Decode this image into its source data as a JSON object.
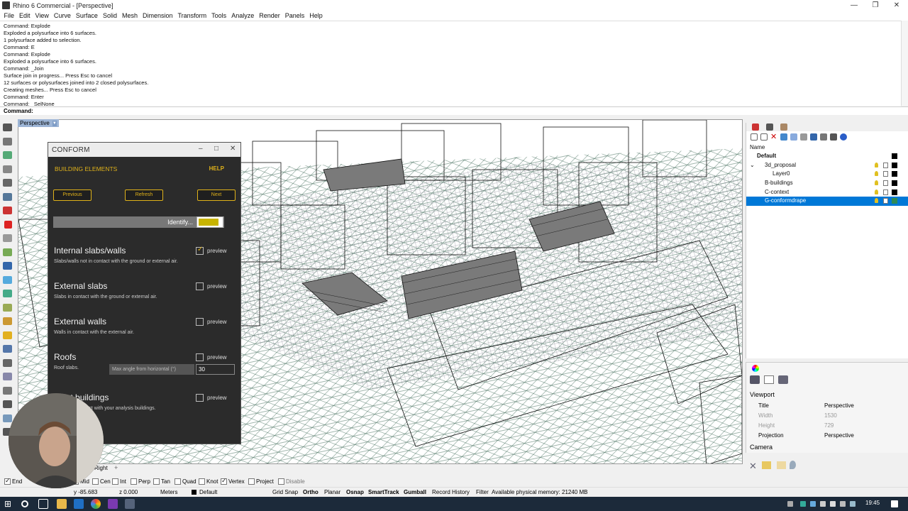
{
  "window": {
    "title": "Rhino 6 Commercial - [Perspective]"
  },
  "menu": [
    "File",
    "Edit",
    "View",
    "Curve",
    "Surface",
    "Solid",
    "Mesh",
    "Dimension",
    "Transform",
    "Tools",
    "Analyze",
    "Render",
    "Panels",
    "Help"
  ],
  "command_history": [
    "Command: Explode",
    "Exploded a polysurface into 6 surfaces.",
    "1 polysurface added to selection.",
    "Command: E",
    "Command: Explode",
    "Exploded a polysurface into 6 surfaces.",
    "Command: _Join",
    "Surface join in progress... Press Esc to cancel",
    "12 surfaces or polysurfaces joined into 2 closed polysurfaces.",
    "Creating meshes... Press Esc to cancel",
    "Command: Enter",
    "Command: _SelNone"
  ],
  "command_prompt": "Command:",
  "viewport": {
    "tab": "Perspective",
    "dropdown_glyph": "▼"
  },
  "conform": {
    "title": "CONFORM",
    "heading": "BUILDING ELEMENTS",
    "help": "HELP",
    "buttons": {
      "previous": "Previous",
      "refresh": "Refresh",
      "next": "Next"
    },
    "identify": "Identify...",
    "identify_color": "#c8b400",
    "preview_label": "preview",
    "sections": [
      {
        "title": "Internal slabs/walls",
        "desc": "Slabs/walls not in contact with the ground or external air.",
        "checked": true
      },
      {
        "title": "External slabs",
        "desc": "Slabs in contact with the ground or external air.",
        "checked": false
      },
      {
        "title": "External walls",
        "desc": "Walls in contact with the external air.",
        "checked": false
      },
      {
        "title": "Roofs",
        "desc": "Roof slabs.",
        "checked": false
      },
      {
        "title": "...ent buildings",
        "desc": "...in direct contact with your analysis buildings.",
        "checked": false
      }
    ],
    "angle_label": "Max angle from horizontal (°)",
    "angle_value": "30"
  },
  "layers": {
    "header": "Name",
    "rows": [
      {
        "name": "Default",
        "bold": true,
        "indent": 0
      },
      {
        "name": "3d_proposal",
        "bold": false,
        "indent": 1,
        "expand": "⌄"
      },
      {
        "name": "Layer0",
        "bold": false,
        "indent": 2
      },
      {
        "name": "B-buildings",
        "bold": false,
        "indent": 1
      },
      {
        "name": "C-context",
        "bold": false,
        "indent": 1
      },
      {
        "name": "G-conformdrape",
        "bold": false,
        "indent": 1,
        "selected": true
      }
    ]
  },
  "properties": {
    "section": "Viewport",
    "rows": [
      {
        "key": "Title",
        "value": "Perspective",
        "dim": false
      },
      {
        "key": "Width",
        "value": "1530",
        "dim": true
      },
      {
        "key": "Height",
        "value": "729",
        "dim": true
      },
      {
        "key": "Projection",
        "value": "Perspective",
        "dim": false
      }
    ],
    "camera": "Camera"
  },
  "viewtabs": {
    "right": "Right"
  },
  "osnaps": [
    {
      "label": "End",
      "on": true
    },
    {
      "label": "Mid",
      "on": false
    },
    {
      "label": "Cen",
      "on": false
    },
    {
      "label": "Int",
      "on": false
    },
    {
      "label": "Perp",
      "on": false
    },
    {
      "label": "Tan",
      "on": false
    },
    {
      "label": "Quad",
      "on": false
    },
    {
      "label": "Knot",
      "on": false
    },
    {
      "label": "Vertex",
      "on": true
    },
    {
      "label": "Project",
      "on": false
    },
    {
      "label": "Disable",
      "on": false
    }
  ],
  "status": {
    "y": "y -85.683",
    "z": "z 0.000",
    "units": "Meters",
    "layer": "Default",
    "grid_snap": "Grid Snap",
    "ortho": "Ortho",
    "planar": "Planar",
    "osnap": "Osnap",
    "smarttrack": "SmartTrack",
    "gumball": "Gumball",
    "record": "Record History",
    "filter": "Filter",
    "memory": "Available physical memory: 21240 MB"
  },
  "clock": "19:45"
}
